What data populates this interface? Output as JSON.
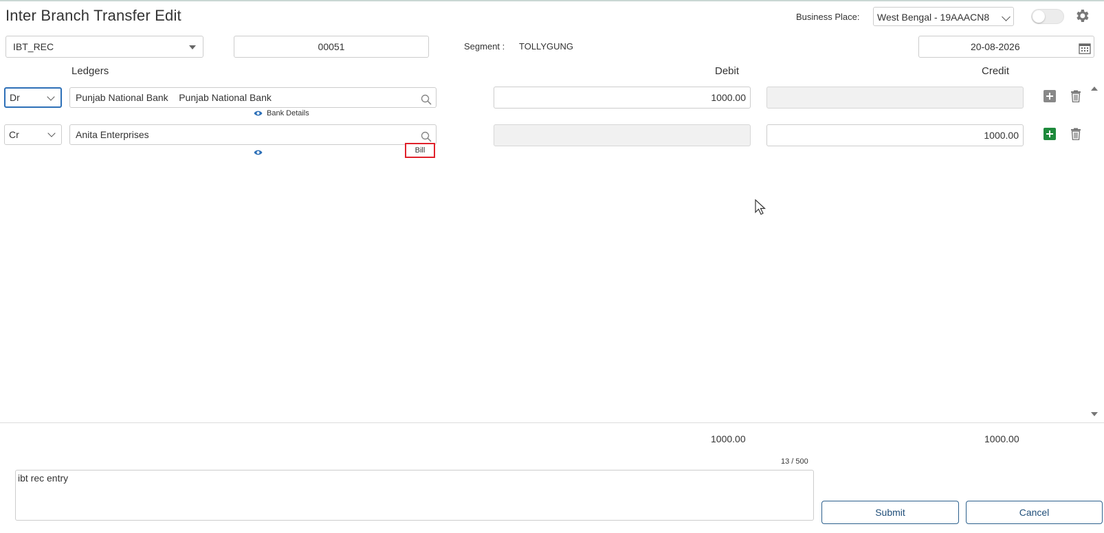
{
  "header": {
    "title": "Inter Branch Transfer Edit",
    "business_place_label": "Business Place:",
    "business_place_value": "West Bengal - 19AAACN8"
  },
  "voucher": {
    "type": "IBT_REC",
    "number": "00051",
    "segment_label": "Segment :",
    "segment_value": "TOLLYGUNG",
    "date": "20-08-2026"
  },
  "columns": {
    "ledgers": "Ledgers",
    "debit": "Debit",
    "credit": "Credit"
  },
  "rows": [
    {
      "drcr": "Dr",
      "ledger": "Punjab National Bank    Punjab National Bank",
      "debit": "1000.00",
      "credit": "",
      "details_label": "Bank Details"
    },
    {
      "drcr": "Cr",
      "ledger": "Anita Enterprises",
      "debit": "",
      "credit": "1000.00",
      "bill_label": "Bill"
    }
  ],
  "totals": {
    "debit": "1000.00",
    "credit": "1000.00"
  },
  "narration": {
    "text": "ibt rec entry",
    "counter": "13 / 500"
  },
  "actions": {
    "submit": "Submit",
    "cancel": "Cancel"
  },
  "colors": {
    "accent": "#2c6fb7",
    "add_green": "#1e8a3c",
    "highlight_red": "#e0202a"
  }
}
